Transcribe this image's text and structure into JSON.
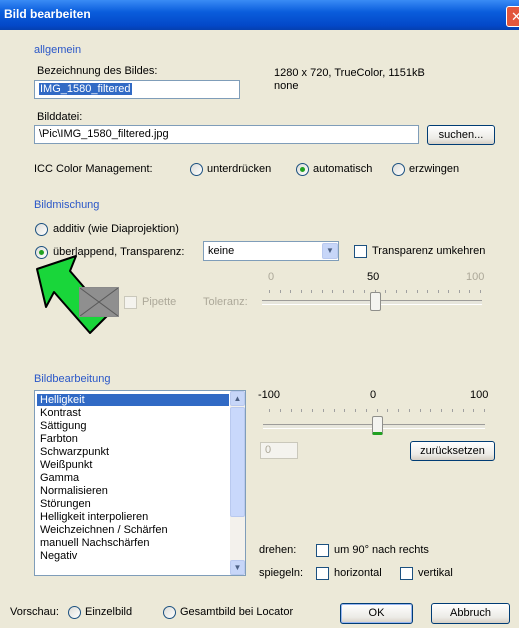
{
  "window": {
    "title": "Bild bearbeiten",
    "close_glyph": "✕"
  },
  "general": {
    "section_title": "allgemein",
    "name_label": "Bezeichnung des Bildes:",
    "name_value": "IMG_1580_filtered",
    "info_line1": "1280 x 720, TrueColor, 1151kB",
    "info_line2": "none",
    "file_label": "Bilddatei:",
    "file_value": "\\Pic\\IMG_1580_filtered.jpg",
    "search_button": "suchen...",
    "icc_label": "ICC Color Management:",
    "icc_options": [
      "unterdrücken",
      "automatisch",
      "erzwingen"
    ],
    "icc_selected": "automatisch"
  },
  "blending": {
    "section_title": "Bildmischung",
    "additive_label": "additiv (wie Diaprojektion)",
    "overlap_label": "überlappend, Transparenz:",
    "selected_mode": "überlappend, Transparenz:",
    "transparency_value": "keine",
    "invert_label": "Transparenz umkehren",
    "pipette_label": "Pipette",
    "tolerance_label": "Toleranz:",
    "scale": [
      "0",
      "50",
      "100"
    ],
    "tolerance_value": 50,
    "pointer": {
      "icon": "green-arrow-icon",
      "color": "#19d63a"
    }
  },
  "editing": {
    "section_title": "Bildbearbeitung",
    "adjustments": [
      "Helligkeit",
      "Kontrast",
      "Sättigung",
      "Farbton",
      "Schwarzpunkt",
      "Weißpunkt",
      "Gamma",
      "Normalisieren",
      "Störungen",
      "Helligkeit interpolieren",
      "Weichzeichnen / Schärfen",
      "manuell Nachschärfen",
      "Negativ"
    ],
    "selected": "Helligkeit",
    "scale": [
      "-100",
      "0",
      "100"
    ],
    "slider_value": 0,
    "value_box": "0",
    "reset_button": "zurücksetzen",
    "rotate_label": "drehen:",
    "rotate_option": "um 90° nach rechts",
    "mirror_label": "spiegeln:",
    "mirror_horizontal": "horizontal",
    "mirror_vertical": "vertikal"
  },
  "footer": {
    "preview_label": "Vorschau:",
    "preview_options": [
      "Einzelbild",
      "Gesamtbild bei Locator"
    ],
    "ok_button": "OK",
    "cancel_button": "Abbruch"
  },
  "colors": {
    "titlebar": "#0a5ddc",
    "section_heading": "#2a57c8",
    "selection": "#316ac5",
    "window_bg": "#ece9d8"
  }
}
